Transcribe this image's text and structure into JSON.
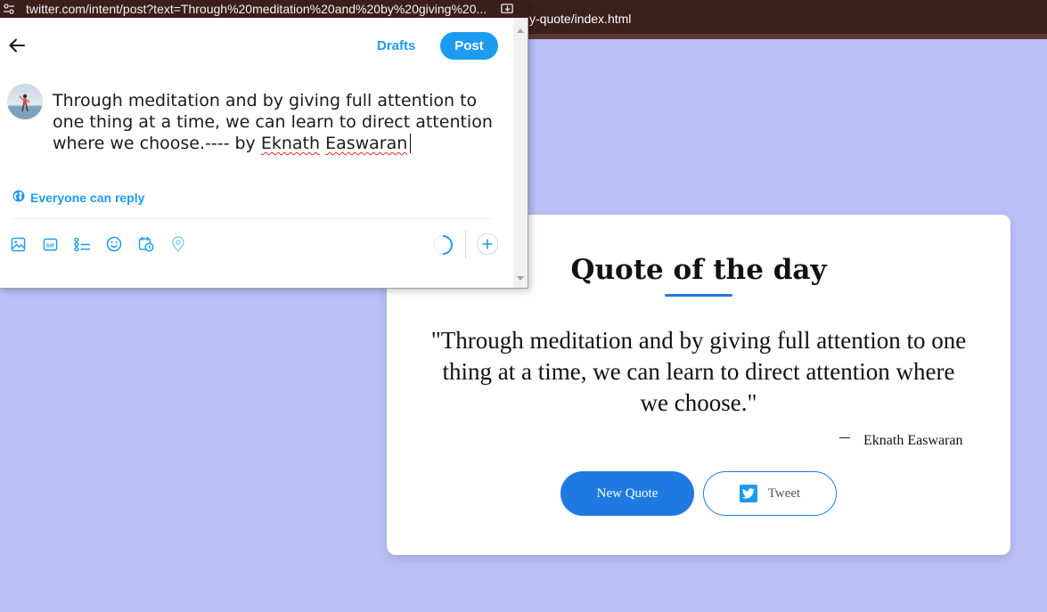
{
  "background_page": {
    "url_fragment": "y-quote/index.html",
    "card": {
      "title": "Quote of the day",
      "quote": "\"Through meditation and by giving full attention to one thing at a time, we can learn to direct attention where we choose.\"",
      "author_dash": "_",
      "author": "Eknath Easwaran",
      "new_quote_label": "New Quote",
      "tweet_label": "Tweet"
    }
  },
  "popup": {
    "url": "twitter.com/intent/post?text=Through%20meditation%20and%20by%20giving%20...",
    "header": {
      "drafts_label": "Drafts",
      "post_label": "Post"
    },
    "compose": {
      "text_main": "Through meditation and by giving full attention to one thing at a time, we can learn to direct attention where we choose.---- by ",
      "text_author_first": "Eknath",
      "text_author_last": "Easwaran"
    },
    "reply_setting": "Everyone can reply",
    "toolbar_icons": [
      "image-icon",
      "gif-icon",
      "poll-icon",
      "emoji-icon",
      "schedule-icon",
      "location-icon"
    ]
  },
  "colors": {
    "accent": "#1d9bf0",
    "card_button": "#1e7ae0",
    "page_background": "#babff7",
    "chrome": "#3b1f1a"
  }
}
